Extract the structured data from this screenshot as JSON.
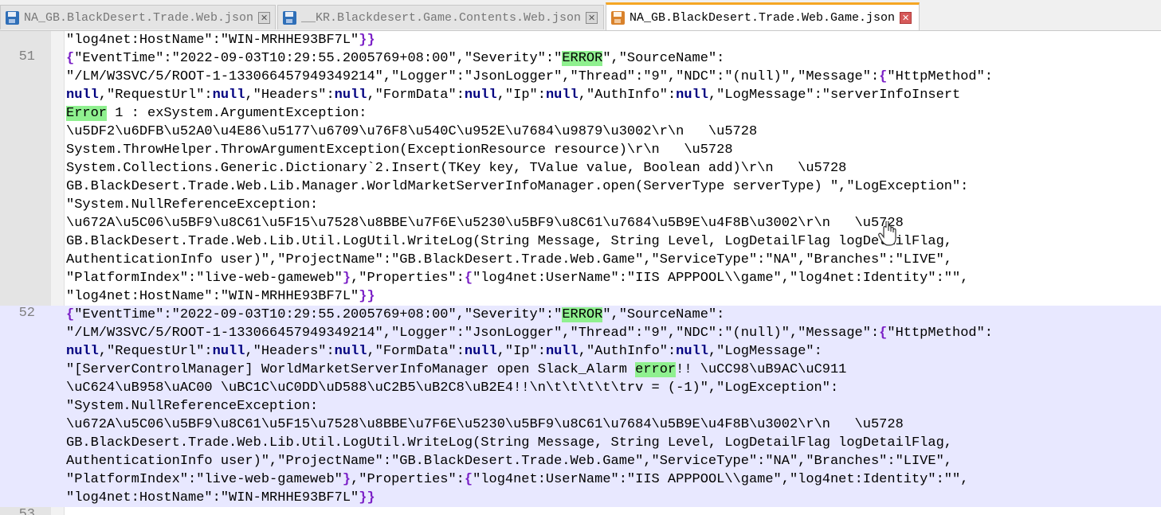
{
  "tabs": [
    {
      "label": "NA_GB.BlackDesert.Trade.Web.json",
      "active": false
    },
    {
      "label": "__KR.Blackdesert.Game.Contents.Web.json",
      "active": false
    },
    {
      "label": "NA_GB.BlackDesert.Trade.Web.Game.json",
      "active": true
    }
  ],
  "colors": {
    "bracket": "#7a1fc6",
    "keyword_null": "#000080",
    "search_highlight": "#8ff08f",
    "current_block_bg": "#e8e8ff",
    "active_tab_accent": "#f5a623"
  },
  "editor": {
    "line_numbers": [
      "51",
      "52",
      "53"
    ],
    "lines": [
      [
        {
          "t": "\"log4net:HostName\":\"WIN-MRHHE93BF7L\""
        },
        {
          "t": "}}",
          "c": "b"
        }
      ],
      [
        {
          "t": "{",
          "c": "b"
        },
        {
          "t": "\"EventTime\":\"2022-09-03T10:29:55.2005769+08:00\",\"Severity\":\""
        },
        {
          "t": "ERROR",
          "c": "m"
        },
        {
          "t": "\",\"SourceName\":"
        }
      ],
      [
        {
          "t": "\"/LM/W3SVC/5/ROOT-1-133066457949349214\",\"Logger\":\"JsonLogger\",\"Thread\":\"9\",\"NDC\":\"(null)\",\"Message\":"
        },
        {
          "t": "{",
          "c": "b"
        },
        {
          "t": "\"HttpMethod\":"
        }
      ],
      [
        {
          "t": "null",
          "c": "k"
        },
        {
          "t": ",\"RequestUrl\":"
        },
        {
          "t": "null",
          "c": "k"
        },
        {
          "t": ",\"Headers\":"
        },
        {
          "t": "null",
          "c": "k"
        },
        {
          "t": ",\"FormData\":"
        },
        {
          "t": "null",
          "c": "k"
        },
        {
          "t": ",\"Ip\":"
        },
        {
          "t": "null",
          "c": "k"
        },
        {
          "t": ",\"AuthInfo\":"
        },
        {
          "t": "null",
          "c": "k"
        },
        {
          "t": ",\"LogMessage\":\"serverInfoInsert"
        }
      ],
      [
        {
          "t": "Error",
          "c": "m"
        },
        {
          "t": " 1 : exSystem.ArgumentException:"
        }
      ],
      [
        {
          "t": "\\u5DF2\\u6DFB\\u52A0\\u4E86\\u5177\\u6709\\u76F8\\u540C\\u952E\\u7684\\u9879\\u3002\\r\\n   \\u5728"
        }
      ],
      [
        {
          "t": "System.ThrowHelper.ThrowArgumentException(ExceptionResource resource)\\r\\n   \\u5728"
        }
      ],
      [
        {
          "t": "System.Collections.Generic.Dictionary`2.Insert(TKey key, TValue value, Boolean add)\\r\\n   \\u5728"
        }
      ],
      [
        {
          "t": "GB.BlackDesert.Trade.Web.Lib.Manager.WorldMarketServerInfoManager.open(ServerType serverType) \",\"LogException\":"
        }
      ],
      [
        {
          "t": "\"System.NullReferenceException:"
        }
      ],
      [
        {
          "t": "\\u672A\\u5C06\\u5BF9\\u8C61\\u5F15\\u7528\\u8BBE\\u7F6E\\u5230\\u5BF9\\u8C61\\u7684\\u5B9E\\u4F8B\\u3002\\r\\n   \\u5728"
        }
      ],
      [
        {
          "t": "GB.BlackDesert.Trade.Web.Lib.Util.LogUtil.WriteLog(String Message, String Level, LogDetailFlag logDetailFlag,"
        }
      ],
      [
        {
          "t": "AuthenticationInfo user)\",\"ProjectName\":\"GB.BlackDesert.Trade.Web.Game\",\"ServiceType\":\"NA\",\"Branches\":\"LIVE\","
        }
      ],
      [
        {
          "t": "\"PlatformIndex\":\"live-web-gameweb\""
        },
        {
          "t": "}",
          "c": "b"
        },
        {
          "t": ",\"Properties\":"
        },
        {
          "t": "{",
          "c": "b"
        },
        {
          "t": "\"log4net:UserName\":\"IIS APPPOOL\\\\game\",\"log4net:Identity\":\"\","
        }
      ],
      [
        {
          "t": "\"log4net:HostName\":\"WIN-MRHHE93BF7L\""
        },
        {
          "t": "}}",
          "c": "b"
        }
      ],
      [
        {
          "t": "{",
          "c": "b"
        },
        {
          "t": "\"EventTime\":\"2022-09-03T10:29:55.2005769+08:00\",\"Severity\":\""
        },
        {
          "t": "ERROR",
          "c": "m"
        },
        {
          "t": "\",\"SourceName\":"
        }
      ],
      [
        {
          "t": "\"/LM/W3SVC/5/ROOT-1-133066457949349214\",\"Logger\":\"JsonLogger\",\"Thread\":\"9\",\"NDC\":\"(null)\",\"Message\":"
        },
        {
          "t": "{",
          "c": "b"
        },
        {
          "t": "\"HttpMethod\":"
        }
      ],
      [
        {
          "t": "null",
          "c": "k"
        },
        {
          "t": ",\"RequestUrl\":"
        },
        {
          "t": "null",
          "c": "k"
        },
        {
          "t": ",\"Headers\":"
        },
        {
          "t": "null",
          "c": "k"
        },
        {
          "t": ",\"FormData\":"
        },
        {
          "t": "null",
          "c": "k"
        },
        {
          "t": ",\"Ip\":"
        },
        {
          "t": "null",
          "c": "k"
        },
        {
          "t": ",\"AuthInfo\":"
        },
        {
          "t": "null",
          "c": "k"
        },
        {
          "t": ",\"LogMessage\":"
        }
      ],
      [
        {
          "t": "\"[ServerControlManager] WorldMarketServerInfoManager open Slack_Alarm "
        },
        {
          "t": "error",
          "c": "m"
        },
        {
          "t": "!! \\uCC98\\uB9AC\\uC911"
        }
      ],
      [
        {
          "t": "\\uC624\\uB958\\uAC00 \\uBC1C\\uC0DD\\uD588\\uC2B5\\uB2C8\\uB2E4!!\\n\\t\\t\\t\\t\\trv = (-1)\",\"LogException\":"
        }
      ],
      [
        {
          "t": "\"System.NullReferenceException:"
        }
      ],
      [
        {
          "t": "\\u672A\\u5C06\\u5BF9\\u8C61\\u5F15\\u7528\\u8BBE\\u7F6E\\u5230\\u5BF9\\u8C61\\u7684\\u5B9E\\u4F8B\\u3002\\r\\n   \\u5728"
        }
      ],
      [
        {
          "t": "GB.BlackDesert.Trade.Web.Lib.Util.LogUtil.WriteLog(String Message, String Level, LogDetailFlag logDetailFlag,"
        }
      ],
      [
        {
          "t": "AuthenticationInfo user)\",\"ProjectName\":\"GB.BlackDesert.Trade.Web.Game\",\"ServiceType\":\"NA\",\"Branches\":\"LIVE\","
        }
      ],
      [
        {
          "t": "\"PlatformIndex\":\"live-web-gameweb\""
        },
        {
          "t": "}",
          "c": "b"
        },
        {
          "t": ",\"Properties\":"
        },
        {
          "t": "{",
          "c": "b"
        },
        {
          "t": "\"log4net:UserName\":\"IIS APPPOOL\\\\game\",\"log4net:Identity\":\"\","
        }
      ],
      [
        {
          "t": "\"log4net:HostName\":\"WIN-MRHHE93BF7L\""
        },
        {
          "t": "}}",
          "c": "b"
        }
      ]
    ]
  }
}
